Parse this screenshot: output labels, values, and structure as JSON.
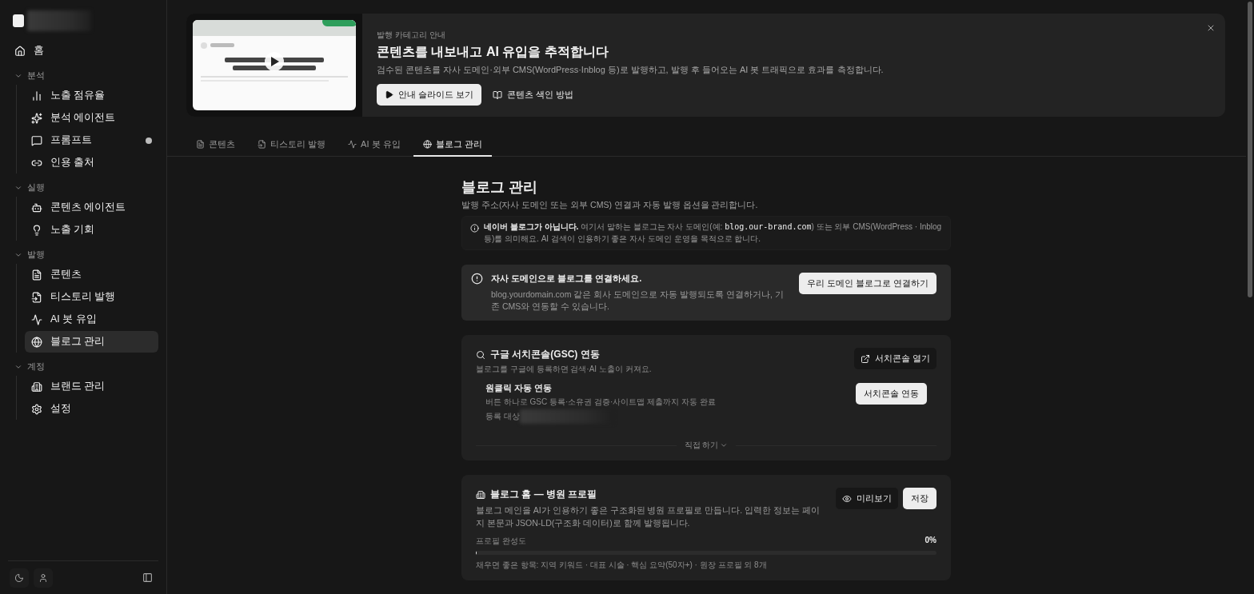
{
  "sidebar": {
    "home": {
      "label": "홈",
      "selected": false
    },
    "sections": [
      {
        "title": "분석",
        "expanded": true,
        "items": [
          {
            "label": "노출 점유율",
            "selected": false,
            "notice": false
          },
          {
            "label": "분석 에이전트",
            "selected": false,
            "notice": false
          },
          {
            "label": "프롬프트",
            "selected": false,
            "notice": true
          },
          {
            "label": "인용 출처",
            "selected": false,
            "notice": false
          }
        ]
      },
      {
        "title": "실행",
        "expanded": true,
        "items": [
          {
            "label": "콘텐츠 에이전트",
            "selected": false,
            "notice": false
          },
          {
            "label": "노출 기회",
            "selected": false,
            "notice": false
          }
        ]
      },
      {
        "title": "발행",
        "expanded": true,
        "items": [
          {
            "label": "콘텐츠",
            "selected": false,
            "notice": false
          },
          {
            "label": "티스토리 발행",
            "selected": false,
            "notice": false
          },
          {
            "label": "AI 봇 유입",
            "selected": false,
            "notice": false
          },
          {
            "label": "블로그 관리",
            "selected": true,
            "notice": false
          }
        ]
      },
      {
        "title": "계정",
        "expanded": true,
        "items": [
          {
            "label": "브랜드 관리",
            "selected": false,
            "notice": false
          },
          {
            "label": "설정",
            "selected": false,
            "notice": false
          }
        ]
      }
    ]
  },
  "banner": {
    "eyebrow": "발행 카테고리 안내",
    "title": "콘텐츠를 내보내고 AI 유입을 추적합니다",
    "description": "검수된 콘텐츠를 자사 도메인·외부 CMS(WordPress·Inblog 등)로 발행하고, 발행 후 들어오는 AI 봇 트래픽으로 효과를 측정합니다.",
    "primary": "안내 슬라이드 보기",
    "secondary": "콘텐츠 색인 방법"
  },
  "tabs": [
    {
      "label": "콘텐츠",
      "selected": false
    },
    {
      "label": "티스토리 발행",
      "selected": false
    },
    {
      "label": "AI 봇 유입",
      "selected": false
    },
    {
      "label": "블로그 관리",
      "selected": true
    }
  ],
  "page": {
    "title": "블로그 관리",
    "subtitle": "발행 주소(자사 도메인 또는 외부 CMS) 연결과 자동 발행 옵션을 관리합니다.",
    "note": {
      "lead": "네이버 블로그가 아닙니다.",
      "before": " 여기서 말하는 블로그는 자사 도메인(예: ",
      "code": "blog.our-brand.com",
      "after": ") 또는 외부 CMS(WordPress · Inblog 등)를 의미해요. AI 검색이 인용하기 좋은 자사 도메인 운영을 목적으로 합니다."
    },
    "alert": {
      "title": "자사 도메인으로 블로그를 연결하세요.",
      "text": "blog.yourdomain.com 같은 회사 도메인으로 자동 발행되도록 연결하거나, 기존 CMS와 연동할 수 있습니다.",
      "button": "우리 도메인 블로그로 연결하기"
    },
    "gsc": {
      "title": "구글 서치콘솔(GSC) 연동",
      "subtitle": "블로그를 구글에 등록하면 검색·AI 노출이 커져요.",
      "open_button": "서치콘솔 열기",
      "oneclick": {
        "title": "원클릭 자동 연동",
        "text": "버튼 하나로 GSC 등록·소유권 검증·사이트맵 제출까지 자동 완료",
        "target_label": "등록 대상",
        "button": "서치콘솔 연동"
      },
      "manual": {
        "label": "직접 하기",
        "expanded": false
      }
    },
    "profile": {
      "title": "블로그 홈 — 병원 프로필",
      "text": "블로그 메인을 AI가 인용하기 좋은 구조화된 병원 프로필로 만듭니다. 입력한 정보는 페이지 본문과 JSON-LD(구조화 데이터)로 함께 발행됩니다.",
      "preview_button": "미리보기",
      "save_button": "저장",
      "progress_label": "프로필 완성도",
      "progress_reading": "0%",
      "level": 0,
      "hint": "채우면 좋은 항목: 지역 키워드 · 대표 시술 · 핵심 요약(50자+) · 원장 프로필 외 8개"
    }
  }
}
